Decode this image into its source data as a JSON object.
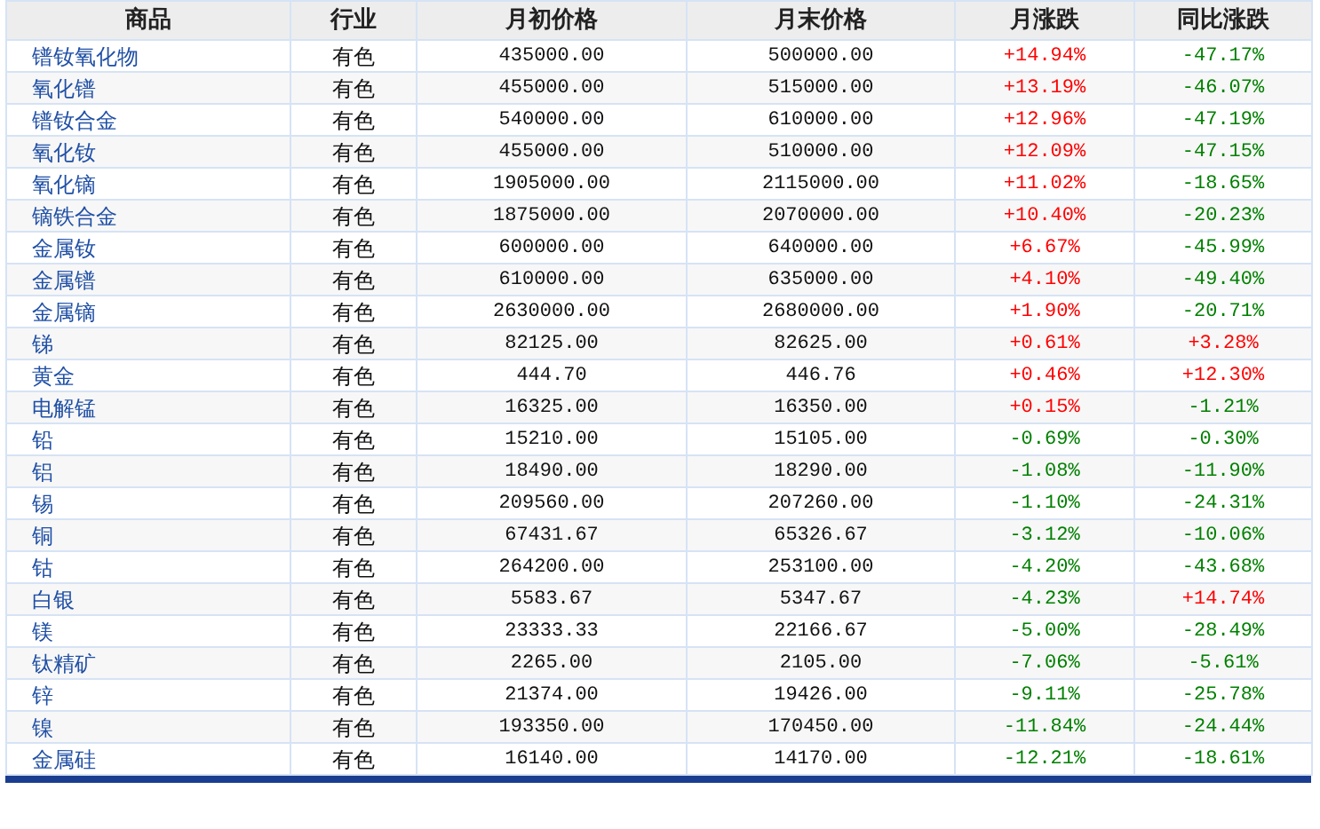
{
  "table": {
    "columns": [
      "商品",
      "行业",
      "月初价格",
      "月末价格",
      "月涨跌",
      "同比涨跌"
    ],
    "rows": [
      {
        "name": "镨钕氧化物",
        "industry": "有色",
        "open": "435000.00",
        "close": "500000.00",
        "month": {
          "text": "+14.94%",
          "color": "#ff0000"
        },
        "yoy": {
          "text": "-47.17%",
          "color": "#008000"
        }
      },
      {
        "name": "氧化镨",
        "industry": "有色",
        "open": "455000.00",
        "close": "515000.00",
        "month": {
          "text": "+13.19%",
          "color": "#ff0000"
        },
        "yoy": {
          "text": "-46.07%",
          "color": "#008000"
        }
      },
      {
        "name": "镨钕合金",
        "industry": "有色",
        "open": "540000.00",
        "close": "610000.00",
        "month": {
          "text": "+12.96%",
          "color": "#ff0000"
        },
        "yoy": {
          "text": "-47.19%",
          "color": "#008000"
        }
      },
      {
        "name": "氧化钕",
        "industry": "有色",
        "open": "455000.00",
        "close": "510000.00",
        "month": {
          "text": "+12.09%",
          "color": "#ff0000"
        },
        "yoy": {
          "text": "-47.15%",
          "color": "#008000"
        }
      },
      {
        "name": "氧化镝",
        "industry": "有色",
        "open": "1905000.00",
        "close": "2115000.00",
        "month": {
          "text": "+11.02%",
          "color": "#ff0000"
        },
        "yoy": {
          "text": "-18.65%",
          "color": "#008000"
        }
      },
      {
        "name": "镝铁合金",
        "industry": "有色",
        "open": "1875000.00",
        "close": "2070000.00",
        "month": {
          "text": "+10.40%",
          "color": "#ff0000"
        },
        "yoy": {
          "text": "-20.23%",
          "color": "#008000"
        }
      },
      {
        "name": "金属钕",
        "industry": "有色",
        "open": "600000.00",
        "close": "640000.00",
        "month": {
          "text": "+6.67%",
          "color": "#ff0000"
        },
        "yoy": {
          "text": "-45.99%",
          "color": "#008000"
        }
      },
      {
        "name": "金属镨",
        "industry": "有色",
        "open": "610000.00",
        "close": "635000.00",
        "month": {
          "text": "+4.10%",
          "color": "#ff0000"
        },
        "yoy": {
          "text": "-49.40%",
          "color": "#008000"
        }
      },
      {
        "name": "金属镝",
        "industry": "有色",
        "open": "2630000.00",
        "close": "2680000.00",
        "month": {
          "text": "+1.90%",
          "color": "#ff0000"
        },
        "yoy": {
          "text": "-20.71%",
          "color": "#008000"
        }
      },
      {
        "name": "锑",
        "industry": "有色",
        "open": "82125.00",
        "close": "82625.00",
        "month": {
          "text": "+0.61%",
          "color": "#ff0000"
        },
        "yoy": {
          "text": "+3.28%",
          "color": "#ff0000"
        }
      },
      {
        "name": "黄金",
        "industry": "有色",
        "open": "444.70",
        "close": "446.76",
        "month": {
          "text": "+0.46%",
          "color": "#ff0000"
        },
        "yoy": {
          "text": "+12.30%",
          "color": "#ff0000"
        }
      },
      {
        "name": "电解锰",
        "industry": "有色",
        "open": "16325.00",
        "close": "16350.00",
        "month": {
          "text": "+0.15%",
          "color": "#ff0000"
        },
        "yoy": {
          "text": "-1.21%",
          "color": "#008000"
        }
      },
      {
        "name": "铅",
        "industry": "有色",
        "open": "15210.00",
        "close": "15105.00",
        "month": {
          "text": "-0.69%",
          "color": "#008000"
        },
        "yoy": {
          "text": "-0.30%",
          "color": "#008000"
        }
      },
      {
        "name": "铝",
        "industry": "有色",
        "open": "18490.00",
        "close": "18290.00",
        "month": {
          "text": "-1.08%",
          "color": "#008000"
        },
        "yoy": {
          "text": "-11.90%",
          "color": "#008000"
        }
      },
      {
        "name": "锡",
        "industry": "有色",
        "open": "209560.00",
        "close": "207260.00",
        "month": {
          "text": "-1.10%",
          "color": "#008000"
        },
        "yoy": {
          "text": "-24.31%",
          "color": "#008000"
        }
      },
      {
        "name": "铜",
        "industry": "有色",
        "open": "67431.67",
        "close": "65326.67",
        "month": {
          "text": "-3.12%",
          "color": "#008000"
        },
        "yoy": {
          "text": "-10.06%",
          "color": "#008000"
        }
      },
      {
        "name": "钴",
        "industry": "有色",
        "open": "264200.00",
        "close": "253100.00",
        "month": {
          "text": "-4.20%",
          "color": "#008000"
        },
        "yoy": {
          "text": "-43.68%",
          "color": "#008000"
        }
      },
      {
        "name": "白银",
        "industry": "有色",
        "open": "5583.67",
        "close": "5347.67",
        "month": {
          "text": "-4.23%",
          "color": "#008000"
        },
        "yoy": {
          "text": "+14.74%",
          "color": "#ff0000"
        }
      },
      {
        "name": "镁",
        "industry": "有色",
        "open": "23333.33",
        "close": "22166.67",
        "month": {
          "text": "-5.00%",
          "color": "#008000"
        },
        "yoy": {
          "text": "-28.49%",
          "color": "#008000"
        }
      },
      {
        "name": "钛精矿",
        "industry": "有色",
        "open": "2265.00",
        "close": "2105.00",
        "month": {
          "text": "-7.06%",
          "color": "#008000"
        },
        "yoy": {
          "text": "-5.61%",
          "color": "#008000"
        }
      },
      {
        "name": "锌",
        "industry": "有色",
        "open": "21374.00",
        "close": "19426.00",
        "month": {
          "text": "-9.11%",
          "color": "#008000"
        },
        "yoy": {
          "text": "-25.78%",
          "color": "#008000"
        }
      },
      {
        "name": "镍",
        "industry": "有色",
        "open": "193350.00",
        "close": "170450.00",
        "month": {
          "text": "-11.84%",
          "color": "#008000"
        },
        "yoy": {
          "text": "-24.44%",
          "color": "#008000"
        }
      },
      {
        "name": "金属硅",
        "industry": "有色",
        "open": "16140.00",
        "close": "14170.00",
        "month": {
          "text": "-12.21%",
          "color": "#008000"
        },
        "yoy": {
          "text": "-18.61%",
          "color": "#008000"
        }
      }
    ]
  }
}
